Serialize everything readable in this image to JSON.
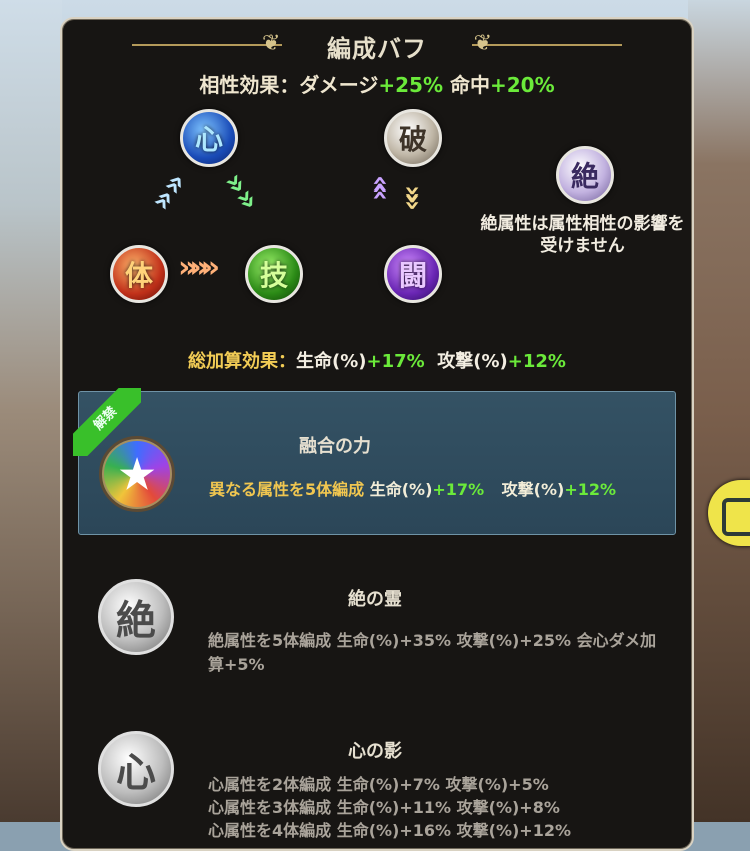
{
  "panel": {
    "title": "編成バフ",
    "affinity": {
      "label": "相性効果：ダメージ",
      "damage_value": "+25%",
      "hit_label": " 命中",
      "hit_value": "+20%"
    },
    "orbs": {
      "shin": "心",
      "tai": "体",
      "gi": "技",
      "ha": "破",
      "to": "闘",
      "zetsu": "絶"
    },
    "zetsu_note": "絶属性は属性相性の影響を受けません",
    "total": {
      "label": "総加算効果：",
      "hp_label": "生命(%)",
      "hp_value": "+17%",
      "atk_label": "攻撃(%)",
      "atk_value": "+12%"
    }
  },
  "cards": [
    {
      "ribbon": "解禁",
      "title": "融合の力",
      "condition": "異なる属性を5体編成",
      "hp_label": "生命(%)",
      "hp_value": "+17%",
      "atk_label": "攻撃(%)",
      "atk_value": "+12%",
      "icon": "star-icon"
    },
    {
      "title": "絶の霊",
      "icon_glyph": "絶",
      "desc": "絶属性を5体編成 生命(%)+35%  攻撃(%)+25%  会心ダメ加算+5%"
    },
    {
      "title": "心の影",
      "icon_glyph": "心",
      "lines": [
        "心属性を2体編成 生命(%)+7%  攻撃(%)+5%",
        "心属性を3体編成 生命(%)+11%  攻撃(%)+8%",
        "心属性を4体編成 生命(%)+16%  攻撃(%)+12%"
      ]
    }
  ],
  "colors": {
    "accent_green": "#6bea3a",
    "accent_gold": "#f2cc55",
    "panel_bg": "#171513"
  }
}
